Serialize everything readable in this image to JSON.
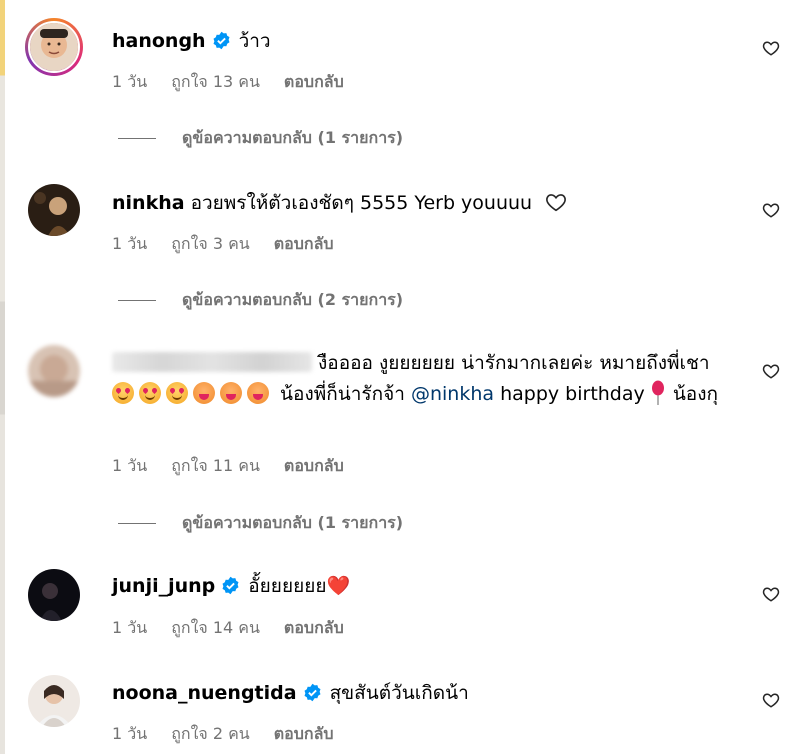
{
  "comments": [
    {
      "username": "hanongh",
      "verified": true,
      "text": "ว้าว",
      "time": "1 วัน",
      "likes": "ถูกใจ 13 คน",
      "reply": "ตอบกลับ",
      "view_replies": "ดูข้อความตอบกลับ (1 รายการ)"
    },
    {
      "username": "ninkha",
      "verified": false,
      "text": "อวยพรให้ตัวเองชัดๆ 5555 Yerb youuuu",
      "time": "1 วัน",
      "likes": "ถูกใจ 3 คน",
      "reply": "ตอบกลับ",
      "view_replies": "ดูข้อความตอบกลับ (2 รายการ)"
    },
    {
      "username_hidden": true,
      "text_part1": "งืออออ งูยยยยยย น่ารักมากเลยค่ะ หมายถึงพี่เชา",
      "text_part2": "น้องพี่ก็น่ารักจ้า",
      "mention": "@ninkha",
      "text_part3": "happy birthday",
      "text_part4": "น้องกุ",
      "time": "1 วัน",
      "likes": "ถูกใจ 11 คน",
      "reply": "ตอบกลับ",
      "view_replies": "ดูข้อความตอบกลับ (1 รายการ)"
    },
    {
      "username": "junji_junp",
      "verified": true,
      "text": "อั้ยยยยยย❤️",
      "time": "1 วัน",
      "likes": "ถูกใจ 14 คน",
      "reply": "ตอบกลับ"
    },
    {
      "username": "noona_nuengtida",
      "verified": true,
      "text": "สุขสันต์วันเกิดน้า",
      "time": "1 วัน",
      "likes": "ถูกใจ 2 คน",
      "reply": "ตอบกลับ"
    }
  ],
  "icons": {
    "verified": "verified-badge-icon",
    "like": "heart-outline-icon",
    "inline_heart": "heart-outline-icon",
    "balloon": "balloon-emoji"
  },
  "colors": {
    "verified": "#0095f6",
    "meta": "#737373",
    "mention": "#00376b",
    "heart_red": "#e0245e"
  }
}
